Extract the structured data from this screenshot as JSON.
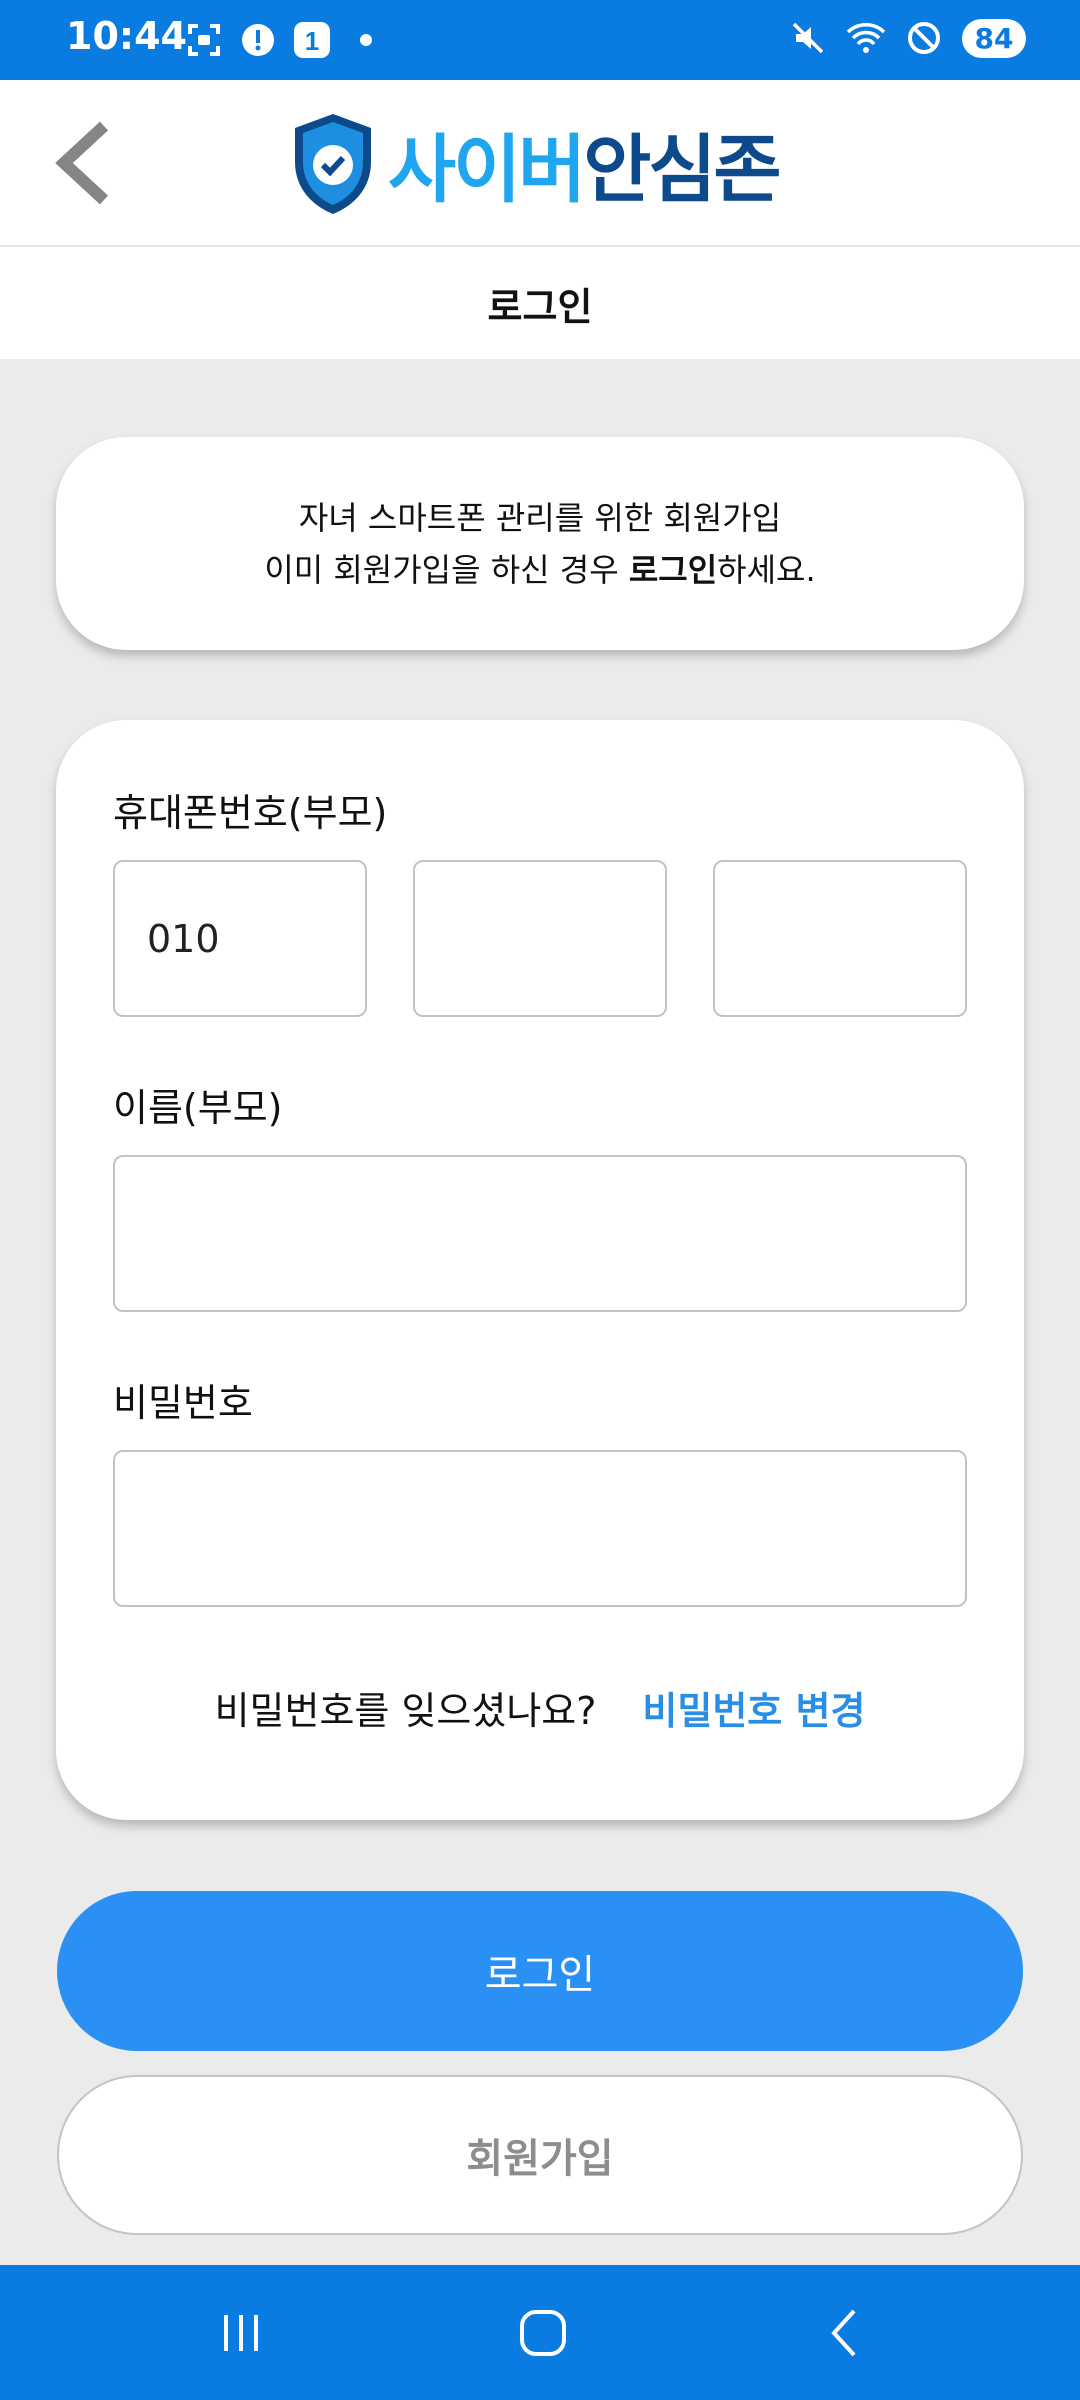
{
  "status_bar": {
    "time": "10:44",
    "notification_count": "1",
    "battery": "84"
  },
  "app_bar": {
    "logo_text_part1": "사이버",
    "logo_text_part2": "안심존"
  },
  "page_title": "로그인",
  "info": {
    "line1": "자녀 스마트폰 관리를 위한 회원가입",
    "line2_prefix": "이미 회원가입을 하신 경우 ",
    "line2_bold": "로그인",
    "line2_suffix": "하세요."
  },
  "form": {
    "phone_label": "휴대폰번호(부모)",
    "phone_part1": "010",
    "phone_part2": "",
    "phone_part3": "",
    "name_label": "이름(부모)",
    "name_value": "",
    "password_label": "비밀번호",
    "password_value": "",
    "forgot_text": "비밀번호를 잊으셨나요?",
    "change_password_link": "비밀번호 변경"
  },
  "buttons": {
    "login": "로그인",
    "signup": "회원가입"
  },
  "colors": {
    "accent": "#2b90f3",
    "status_bar": "#0a7be0",
    "logo_light": "#20a6ee",
    "logo_dark": "#0d4a8b"
  }
}
